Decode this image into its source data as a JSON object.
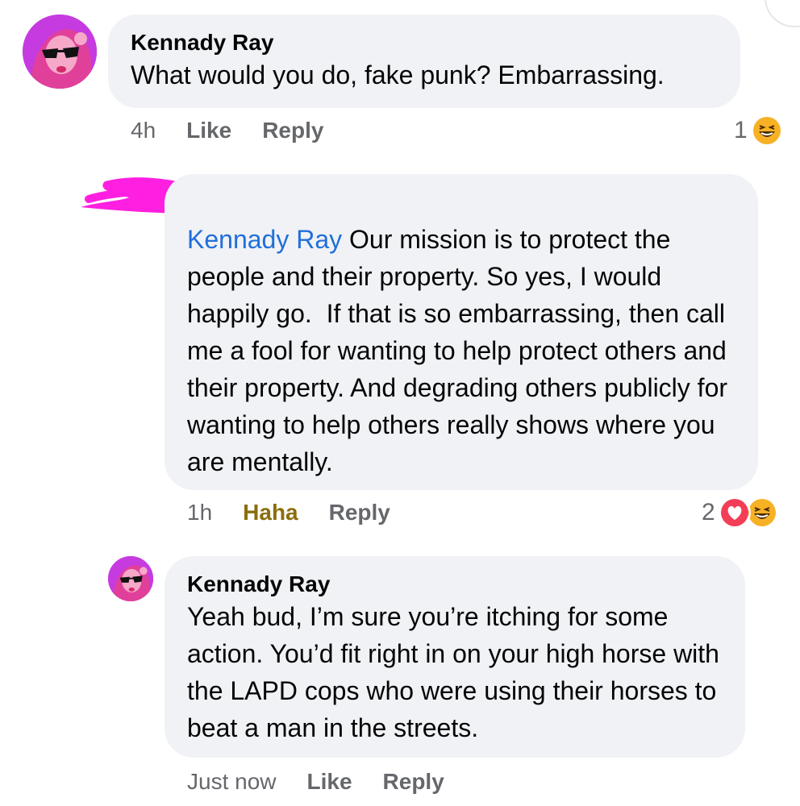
{
  "comments": [
    {
      "author": "Kennady Ray",
      "text": "What would you do, fake punk? Embarrassing.",
      "time": "4h",
      "like_label": "Like",
      "reply_label": "Reply",
      "reaction_count": "1",
      "reaction_icons": [
        "haha-icon"
      ]
    },
    {
      "author_redacted": true,
      "mention": "Kennady Ray",
      "text": " Our mission is to protect the people and their property. So yes, I would happily go.  If that is so embarrassing, then call me a fool for wanting to help protect others and their property. And degrading others publicly for wanting to help others really shows where you are mentally.",
      "time": "1h",
      "like_label": "Haha",
      "reply_label": "Reply",
      "reaction_count": "2",
      "reaction_icons": [
        "love-icon",
        "haha-icon"
      ]
    },
    {
      "author": "Kennady Ray",
      "text": "Yeah bud, I’m sure you’re itching for some action. You’d fit right in on your high horse with the LAPD cops who were using their horses to beat a man in the streets.",
      "time": "Just now",
      "like_label": "Like",
      "reply_label": "Reply"
    }
  ],
  "colors": {
    "bubble": "#f0f2f5",
    "mention": "#216fdb",
    "haha_active": "#8c6d0d",
    "redaction": "#ff1fe0",
    "muted": "#65676b"
  }
}
